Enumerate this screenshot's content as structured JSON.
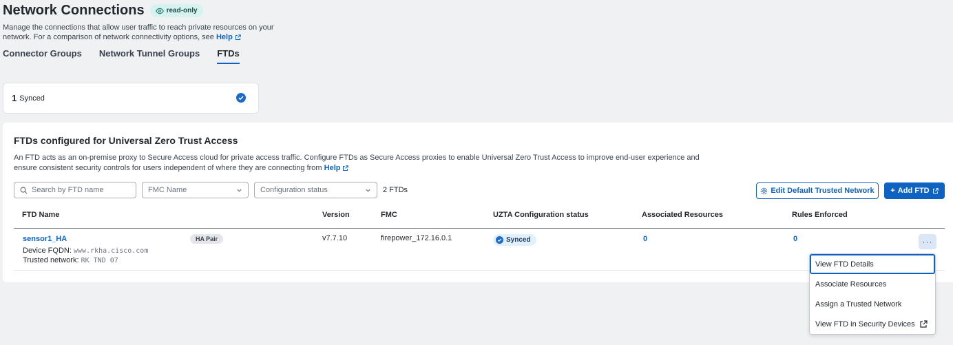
{
  "header": {
    "title": "Network Connections",
    "badge": "read-only",
    "description": "Manage the connections that allow user traffic to reach private resources on your network. For a comparison of network connectivity options, see",
    "help": "Help"
  },
  "tabs": [
    {
      "label": "Connector Groups"
    },
    {
      "label": "Network Tunnel Groups"
    },
    {
      "label": "FTDs",
      "active": true
    }
  ],
  "summary": {
    "count": "1",
    "label": "Synced"
  },
  "section": {
    "title": "FTDs configured for Universal Zero Trust Access",
    "description": "An FTD acts as an on-premise proxy to Secure Access cloud for private access traffic. Configure FTDs as Secure Access proxies to enable Universal Zero Trust Access to improve end-user experience and ensure consistent security controls for users independent of where they are connecting from",
    "help": "Help"
  },
  "filters": {
    "search_placeholder": "Search by FTD name",
    "fmc_placeholder": "FMC Name",
    "status_placeholder": "Configuration status",
    "count": "2 FTDs"
  },
  "buttons": {
    "edit_trusted": "Edit Default Trusted Network",
    "add_ftd": "Add FTD"
  },
  "table": {
    "columns": [
      "FTD Name",
      "Version",
      "FMC",
      "UZTA Configuration status",
      "Associated Resources",
      "Rules Enforced"
    ],
    "rows": [
      {
        "name": "sensor1_HA",
        "badge": "HA Pair",
        "fqdn_label": "Device FQDN:",
        "fqdn": "www.rkha.cisco.com",
        "trusted_label": "Trusted network:",
        "trusted": "RK TND 07",
        "version": "v7.7.10",
        "fmc": "firepower_172.16.0.1",
        "status": "Synced",
        "resources": "0",
        "rules": "0",
        "more": "···"
      }
    ]
  },
  "menu": {
    "items": [
      {
        "label": "View FTD Details"
      },
      {
        "label": "Associate Resources"
      },
      {
        "label": "Assign a Trusted Network"
      },
      {
        "label": "View FTD in Security Devices"
      }
    ]
  },
  "colors": {
    "accent": "#0d62c2",
    "badge_teal": "#d6f3f0",
    "synced_bg": "#e1f1fb"
  }
}
